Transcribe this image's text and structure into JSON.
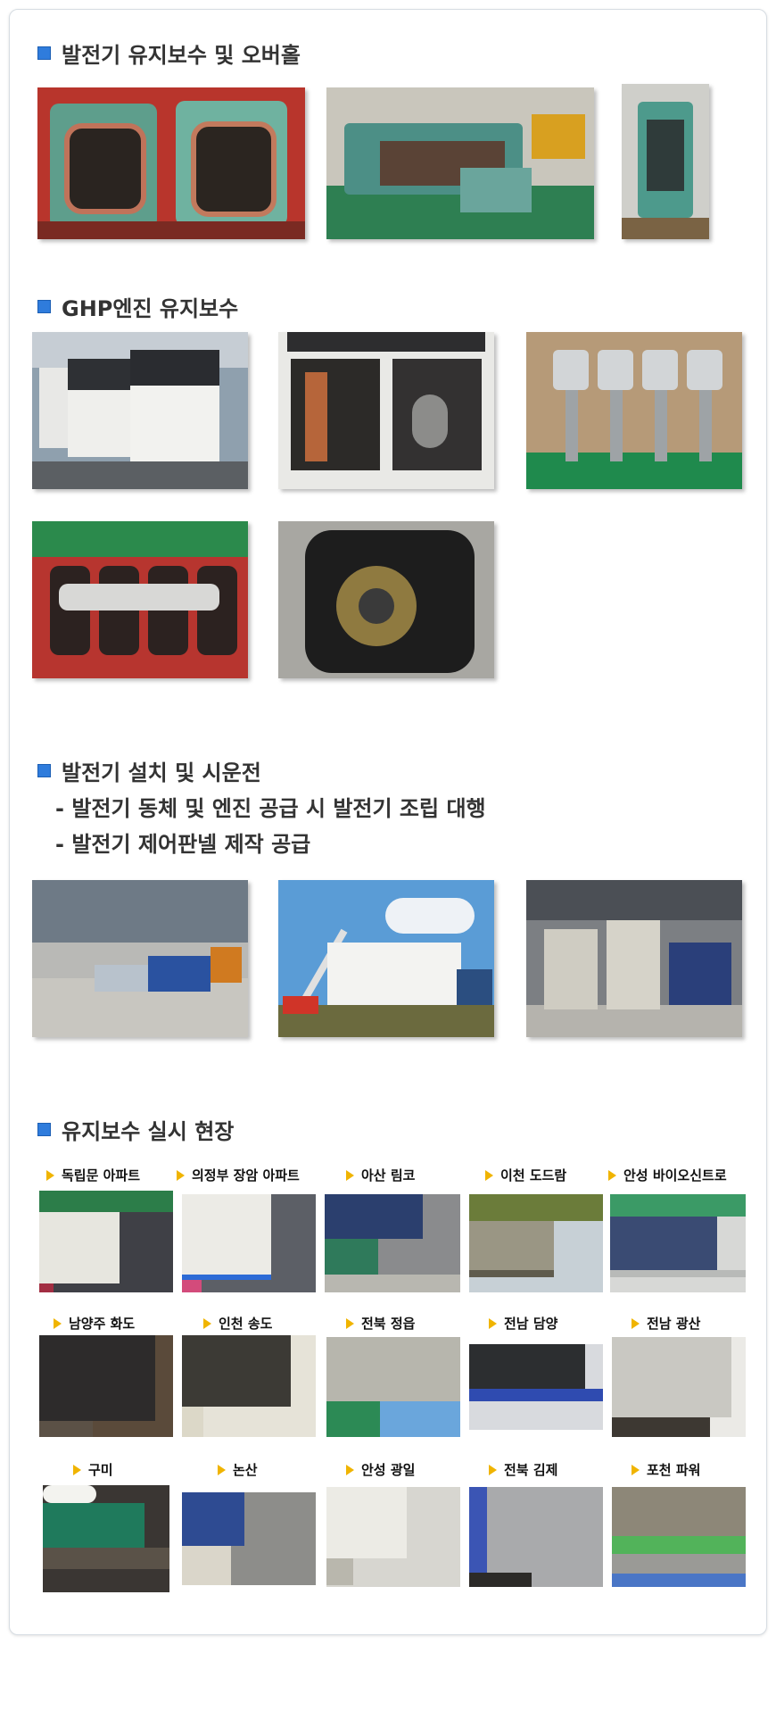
{
  "sections": {
    "s1": {
      "title": "발전기 유지보수 및 오버홀"
    },
    "s2": {
      "title": "GHP엔진 유지보수"
    },
    "s3": {
      "title": "발전기 설치 및 시운전",
      "lines": [
        "- 발전기 동체 및 엔진 공급 시 발전기 조립 대행",
        "- 발전기 제어판넬 제작 공급"
      ]
    },
    "s4": {
      "title": "유지보수 실시 현장"
    }
  },
  "sites": [
    "독립문 아파트",
    "의정부 장암 아파트",
    "아산 림코",
    "이천 도드람",
    "안성 바이오신트로",
    "남양주 화도",
    "인천 송도",
    "전북 정읍",
    "전남 담양",
    "전남 광산",
    "구미",
    "논산",
    "안성 광일",
    "전북 김제",
    "포천 파워"
  ],
  "colors": {
    "accent": "#2f7cdc",
    "marker": "#f0b400",
    "border": "#d7dde3"
  }
}
